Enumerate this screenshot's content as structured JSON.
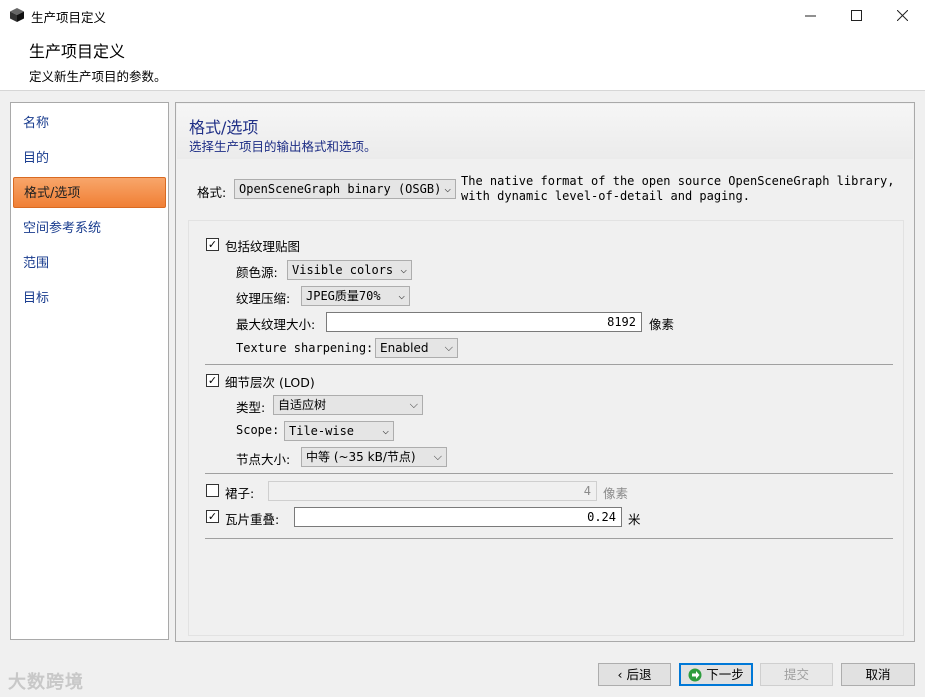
{
  "window": {
    "title": "生产项目定义"
  },
  "header": {
    "title": "生产项目定义",
    "subtitle": "定义新生产项目的参数。"
  },
  "sidebar": {
    "items": [
      {
        "label": "名称",
        "active": false
      },
      {
        "label": "目的",
        "active": false
      },
      {
        "label": "格式/选项",
        "active": true
      },
      {
        "label": "空间参考系统",
        "active": false
      },
      {
        "label": "范围",
        "active": false
      },
      {
        "label": "目标",
        "active": false
      }
    ]
  },
  "section": {
    "title": "格式/选项",
    "subtitle": "选择生产项目的输出格式和选项。"
  },
  "format": {
    "label": "格式:",
    "value": "OpenSceneGraph binary (OSGB)",
    "description_line1": "The native format of the open source OpenSceneGraph library,",
    "description_line2": "with dynamic level-of-detail and paging."
  },
  "textures": {
    "label": "包括纹理贴图",
    "checked": true,
    "color_source_label": "颜色源:",
    "color_source_value": "Visible colors",
    "compression_label": "纹理压缩:",
    "compression_value": "JPEG质量70%",
    "max_size_label": "最大纹理大小:",
    "max_size_value": "8192",
    "max_size_unit": "像素",
    "sharpening_label": "Texture sharpening:",
    "sharpening_value": "Enabled"
  },
  "lod": {
    "label": "细节层次 (LOD)",
    "checked": true,
    "type_label": "类型:",
    "type_value": "自适应树",
    "scope_label": "Scope:",
    "scope_value": "Tile-wise",
    "node_size_label": "节点大小:",
    "node_size_value": "中等 (~35 kB/节点)"
  },
  "skirt": {
    "label": "裙子:",
    "checked": false,
    "value": "4",
    "unit": "像素"
  },
  "overlap": {
    "label": "瓦片重叠:",
    "checked": true,
    "value": "0.24",
    "unit": "米"
  },
  "buttons": {
    "back": "后退",
    "next": "下一步",
    "submit": "提交",
    "cancel": "取消"
  },
  "watermark": "大数跨境",
  "colors": {
    "accent": "#0078d7",
    "active_nav": "#f39a5a",
    "title": "#1f2f86"
  }
}
